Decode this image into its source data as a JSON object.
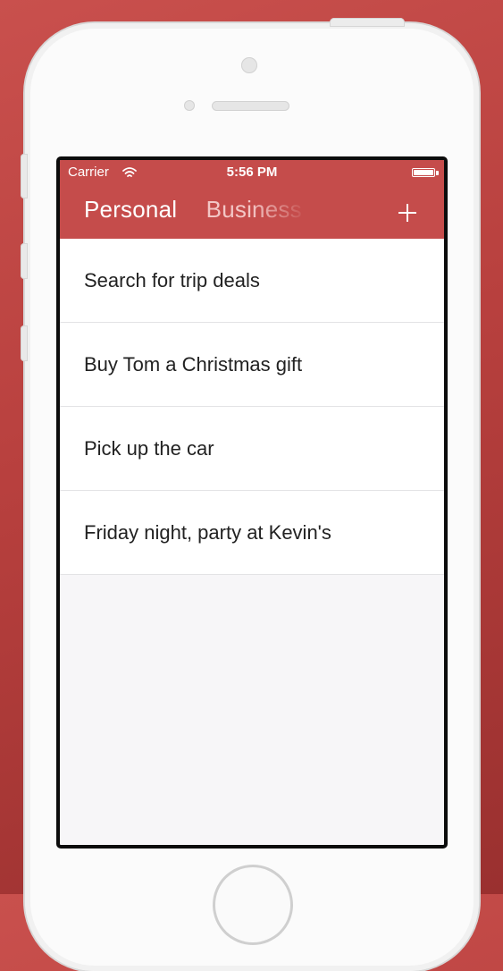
{
  "status_bar": {
    "carrier": "Carrier",
    "time": "5:56 PM",
    "battery_level": 1.0
  },
  "nav": {
    "tabs": [
      {
        "label": "Personal",
        "active": true
      },
      {
        "label": "Business",
        "active": false
      }
    ],
    "add_icon": "plus-icon"
  },
  "tasks": [
    {
      "title": "Search for trip deals"
    },
    {
      "title": "Buy Tom a Christmas gift"
    },
    {
      "title": "Pick up the car"
    },
    {
      "title": "Friday night, party at Kevin's"
    }
  ],
  "colors": {
    "background": "#b8403e",
    "header": "#c54c4b",
    "list_bg": "#ffffff",
    "screen_bg": "#f7f6f8",
    "text": "#222222"
  }
}
